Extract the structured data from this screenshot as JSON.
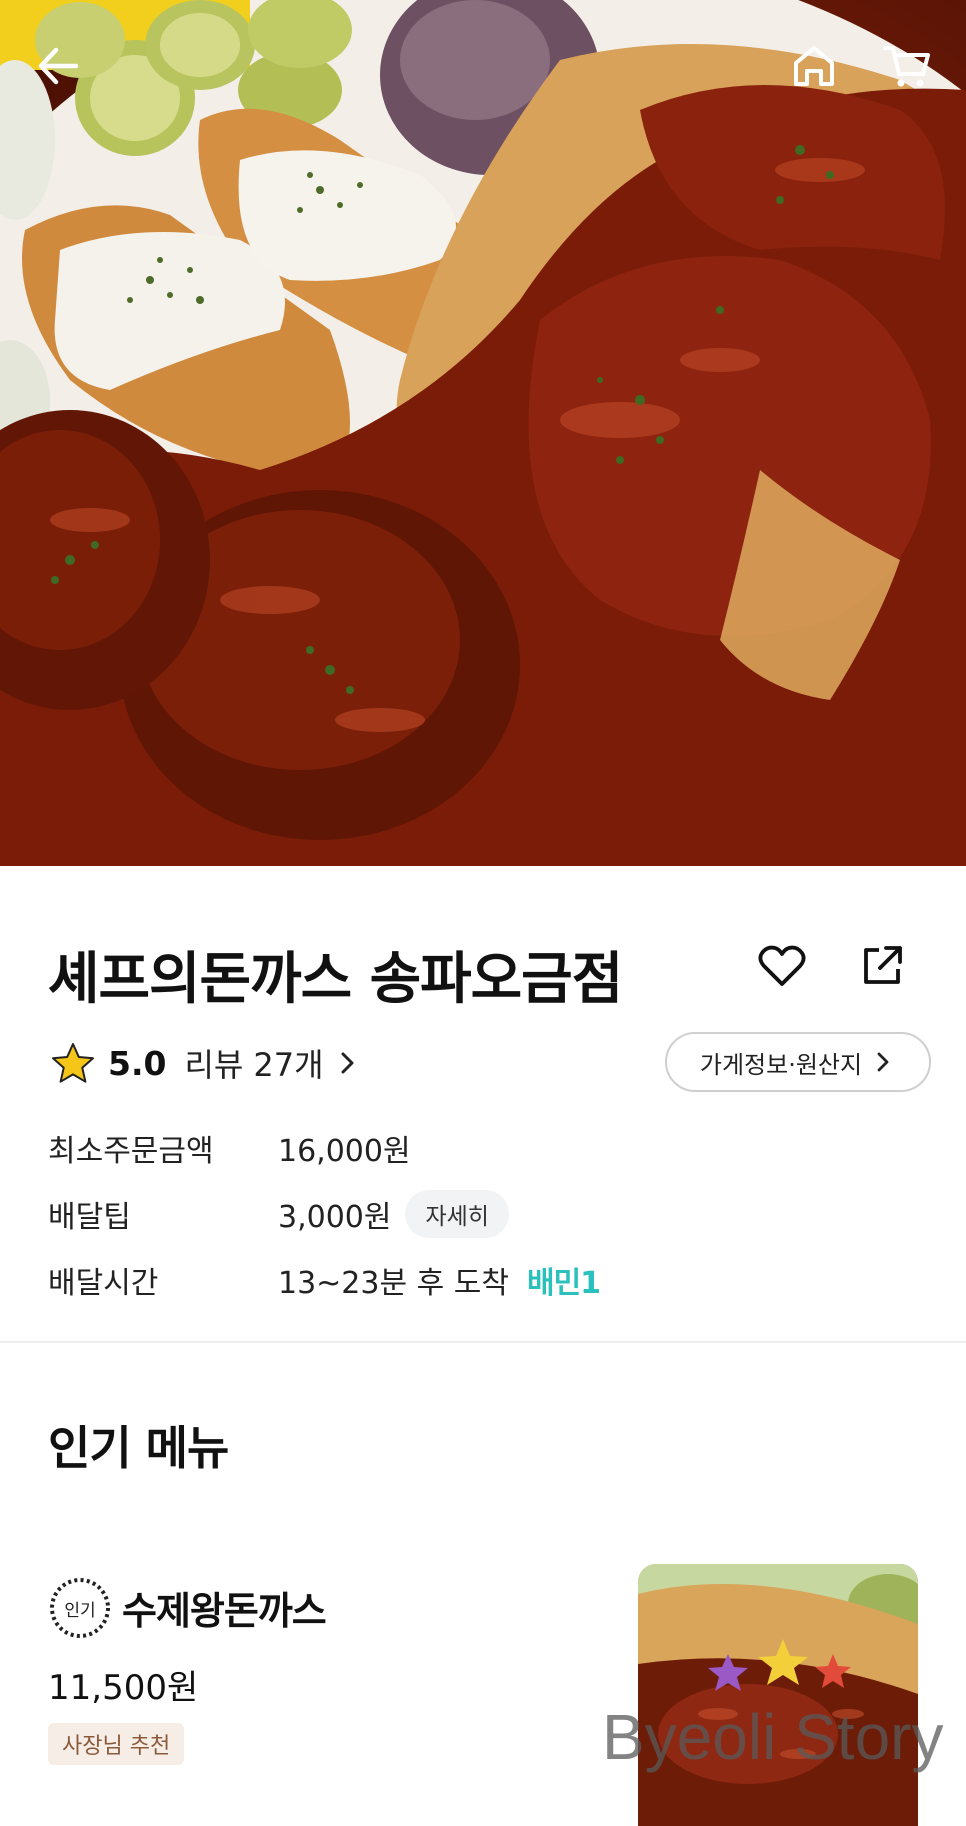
{
  "header": {
    "back_icon": "arrow-left-icon",
    "home_icon": "home-icon",
    "cart_icon": "cart-icon"
  },
  "store": {
    "name": "셰프의돈까스 송파오금점",
    "favorite_icon": "heart-outline-icon",
    "share_icon": "share-icon",
    "rating": "5.0",
    "review_label": "리뷰",
    "review_count": "27개",
    "info_button": "가게정보·원산지",
    "info_rows": [
      {
        "label": "최소주문금액",
        "value": "16,000원"
      },
      {
        "label": "배달팁",
        "value": "3,000원",
        "chip": "자세히"
      },
      {
        "label": "배달시간",
        "value": "13~23분 후 도착",
        "badge": "배민1"
      }
    ]
  },
  "popular_section": {
    "title": "인기 메뉴",
    "items": [
      {
        "badge": "인기",
        "name": "수제왕돈까스",
        "price": "11,500원",
        "tag": "사장님 추천"
      }
    ]
  },
  "watermark": {
    "text": "Byeoli Story"
  },
  "colors": {
    "accent_mint": "#2ac1bc",
    "star_yellow": "#f5c518",
    "tag_bg": "#f6ede7"
  }
}
